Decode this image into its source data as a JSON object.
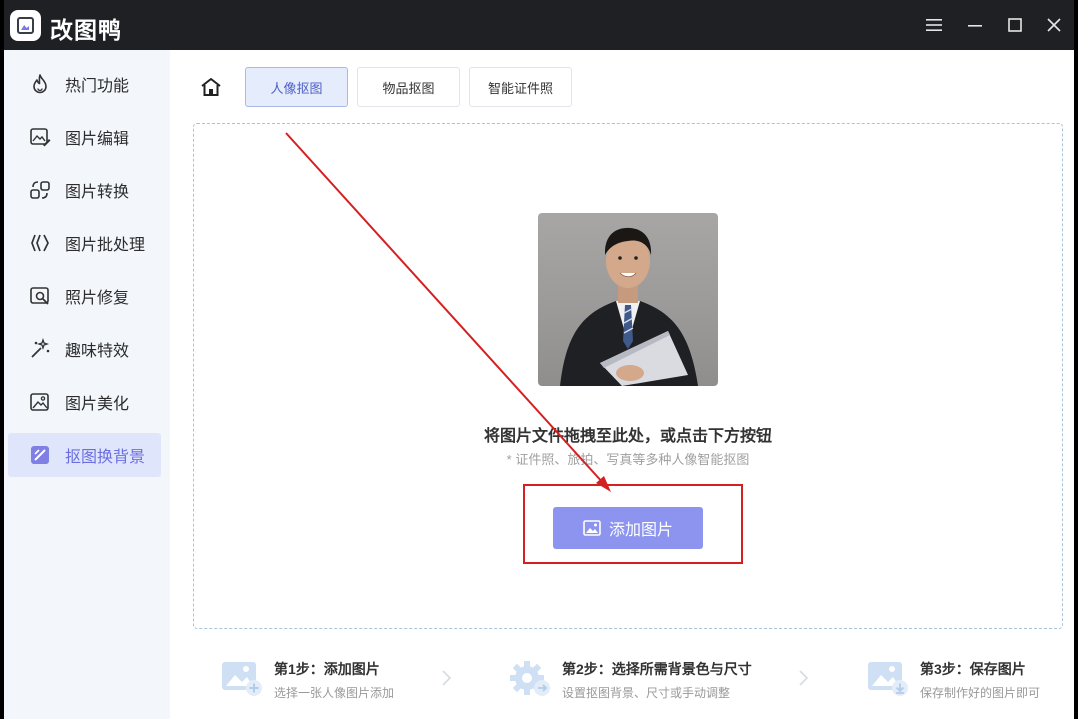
{
  "app": {
    "title": "改图鸭"
  },
  "sidebar": {
    "items": [
      {
        "label": "热门功能"
      },
      {
        "label": "图片编辑"
      },
      {
        "label": "图片转换"
      },
      {
        "label": "图片批处理"
      },
      {
        "label": "照片修复"
      },
      {
        "label": "趣味特效"
      },
      {
        "label": "图片美化"
      },
      {
        "label": "抠图换背景"
      }
    ],
    "active_index": 7
  },
  "tabs": [
    {
      "label": "人像抠图"
    },
    {
      "label": "物品抠图"
    },
    {
      "label": "智能证件照"
    }
  ],
  "dropzone": {
    "title": "将图片文件拖拽至此处，或点击下方按钮",
    "subtitle": "* 证件照、旅拍、写真等多种人像智能抠图",
    "button_label": "添加图片"
  },
  "steps": [
    {
      "title": "第1步：添加图片",
      "desc": "选择一张人像图片添加"
    },
    {
      "title": "第2步：选择所需背景色与尺寸",
      "desc": "设置抠图背景、尺寸或手动调整"
    },
    {
      "title": "第3步：保存图片",
      "desc": "保存制作好的图片即可"
    }
  ],
  "colors": {
    "titlebar": "#1f2024",
    "accent": "#8c94f0",
    "active_nav_bg": "#dfe6fb",
    "annotation_red": "#d42020"
  }
}
